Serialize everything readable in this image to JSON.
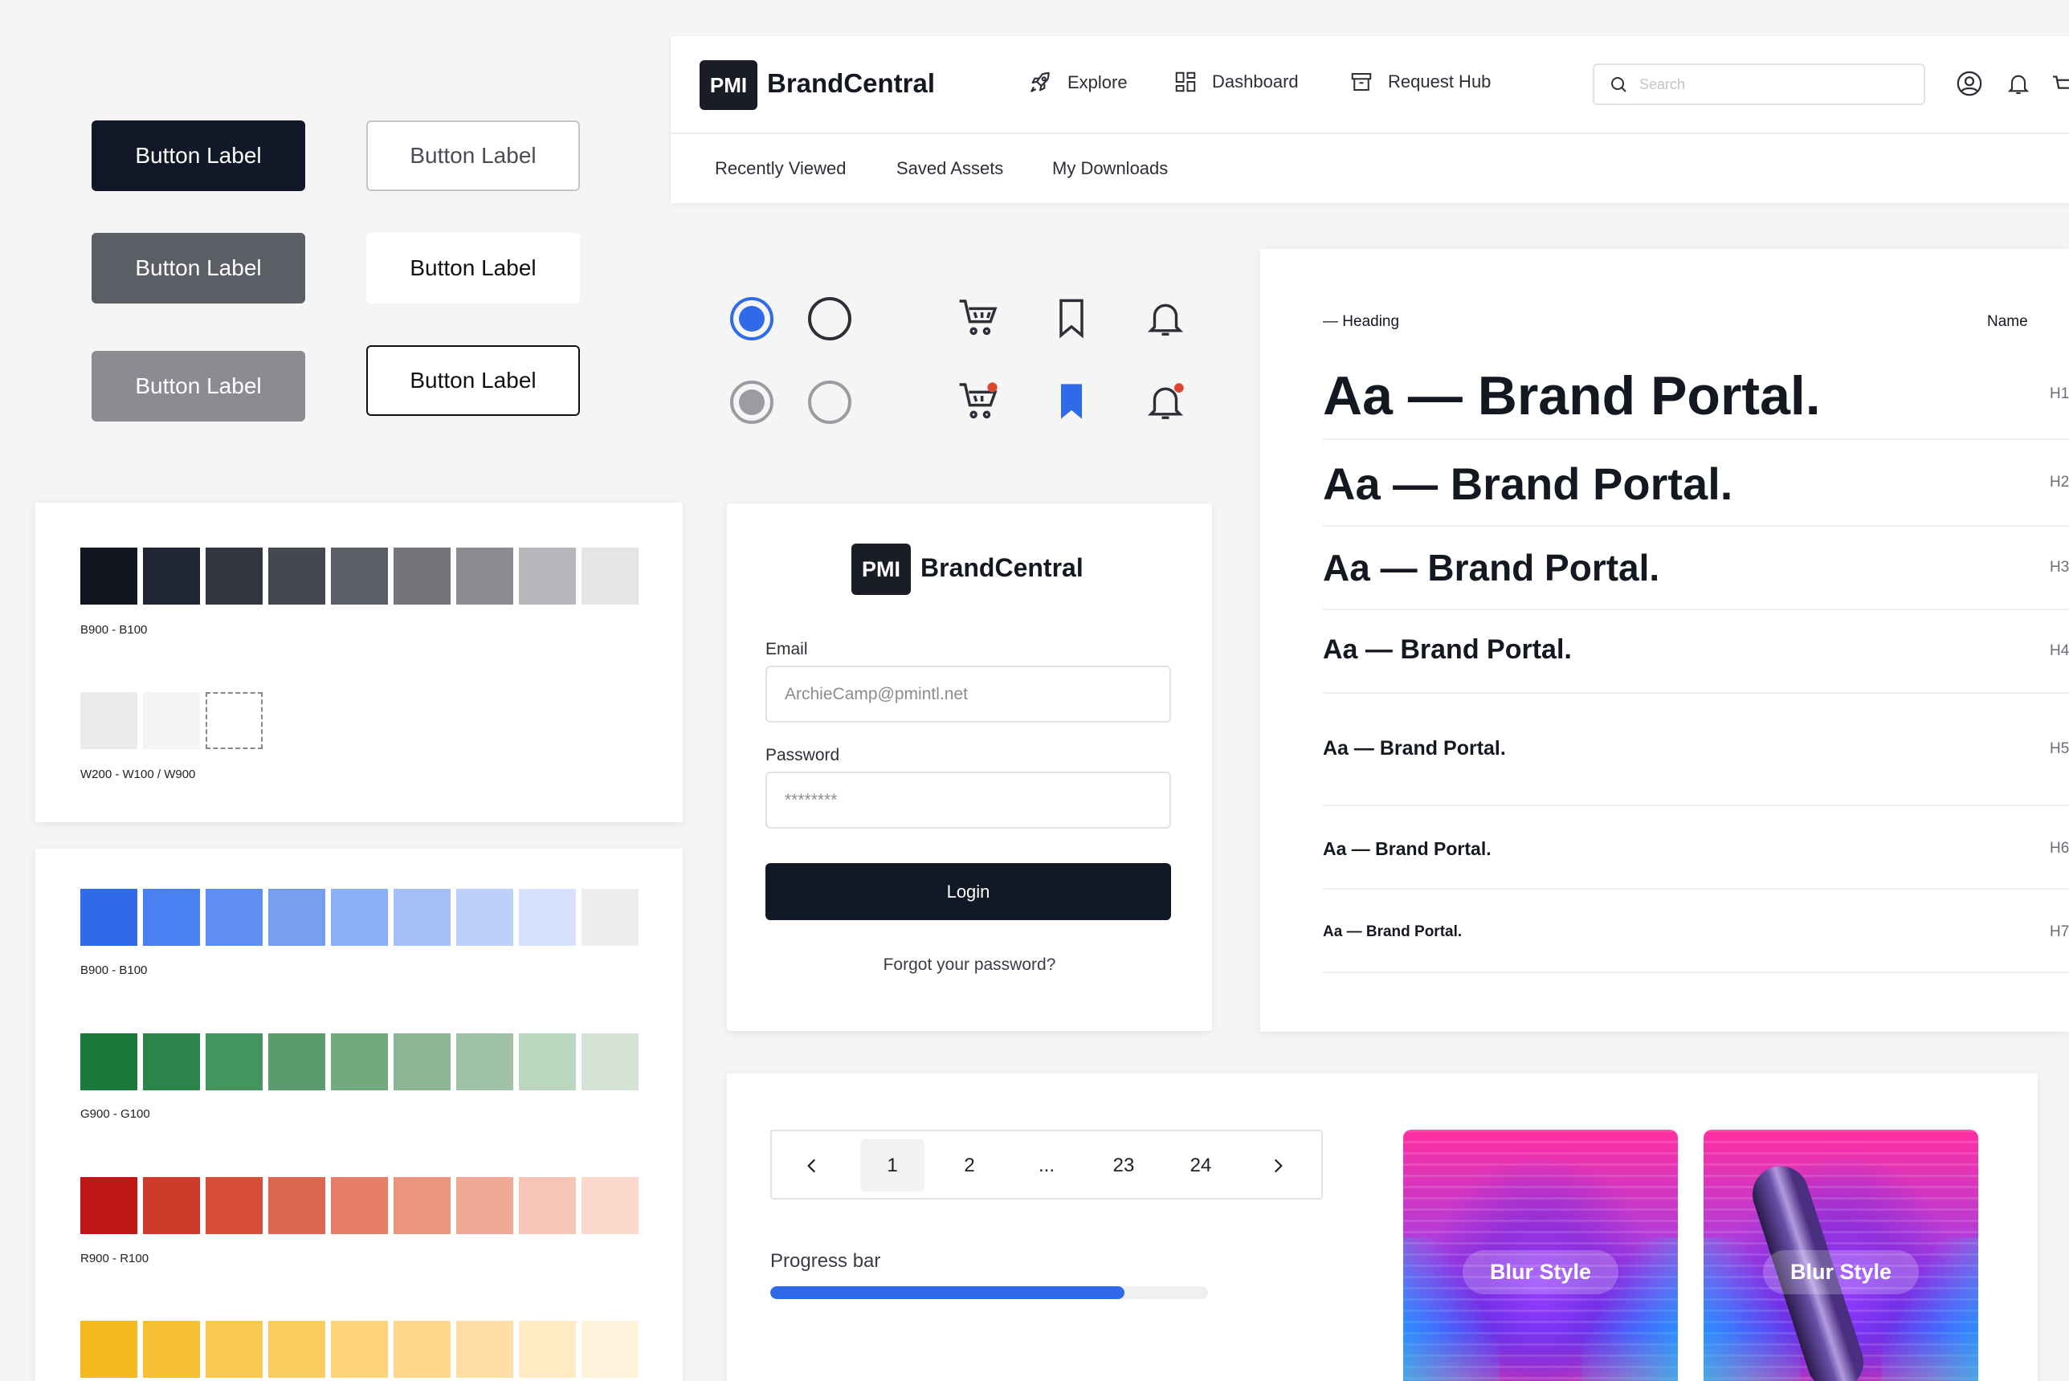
{
  "buttons": [
    {
      "label": "Button Label"
    },
    {
      "label": "Button Label"
    },
    {
      "label": "Button Label"
    },
    {
      "label": "Button Label"
    },
    {
      "label": "Button Label"
    },
    {
      "label": "Button Label"
    }
  ],
  "nav": {
    "logo": "PMI",
    "brand": "BrandCentral",
    "items": [
      {
        "label": "Explore",
        "icon": "rocket-icon"
      },
      {
        "label": "Dashboard",
        "icon": "dashboard-icon"
      },
      {
        "label": "Request Hub",
        "icon": "archive-icon"
      }
    ],
    "search_placeholder": "Search",
    "subnav": [
      "Recently Viewed",
      "Saved Assets",
      "My Downloads"
    ]
  },
  "palettes": {
    "neutral": {
      "label": "B900 - B100",
      "colors": [
        "#111620",
        "#202533",
        "#323641",
        "#454851",
        "#5c5e66",
        "#727479",
        "#8a8c92",
        "#b6b7bb",
        "#e5e5e5"
      ]
    },
    "white": {
      "label": "W200 - W100 / W900",
      "colors": [
        "#ebebeb",
        "#f4f4f4",
        "dashed"
      ]
    },
    "blue": {
      "label": "B900 - B100",
      "colors": [
        "#2f6ae8",
        "#4a80ef",
        "#5e8ff0",
        "#769ff2",
        "#8baff5",
        "#a5c0f7",
        "#bcd0f9",
        "#d6e2fb",
        "#ededed"
      ]
    },
    "green": {
      "label": "G900 - G100",
      "colors": [
        "#1a7a3c",
        "#2b854a",
        "#43945d",
        "#5c9b6d",
        "#73a97e",
        "#8ab694",
        "#a0c2a6",
        "#bcd7bf",
        "#d5e3d5"
      ]
    },
    "red": {
      "label": "R900 - R100",
      "colors": [
        "#c11616",
        "#cc3a2a",
        "#d64e37",
        "#dd6650",
        "#e57d68",
        "#e99580",
        "#f0a995",
        "#f6c5b8",
        "#fbd9cd"
      ]
    },
    "yellow": {
      "colors": [
        "#f5b820",
        "#f7bf33",
        "#f9c84f",
        "#fbcd60",
        "#fdd478",
        "#ffd88c",
        "#ffdeA3",
        "#ffeac4",
        "#fff2da"
      ]
    }
  },
  "login": {
    "logo": "PMI",
    "brand": "BrandCentral",
    "email_label": "Email",
    "email_value": "ArchieCamp@pmintl.net",
    "password_label": "Password",
    "password_value": "********",
    "login_label": "Login",
    "forgot": "Forgot your password?"
  },
  "typography": {
    "col_heading": "Heading",
    "col_name": "Name",
    "rows": [
      {
        "sample": "Aa — Brand Portal.",
        "tag": "H1"
      },
      {
        "sample": "Aa — Brand Portal.",
        "tag": "H2"
      },
      {
        "sample": "Aa — Brand Portal.",
        "tag": "H3"
      },
      {
        "sample": "Aa — Brand Portal.",
        "tag": "H4"
      },
      {
        "sample": "Aa — Brand Portal.",
        "tag": "H5"
      },
      {
        "sample": "Aa — Brand Portal.",
        "tag": "H6"
      },
      {
        "sample": "Aa — Brand Portal.",
        "tag": "H7"
      }
    ]
  },
  "pagination": {
    "pages": [
      "1",
      "2",
      "...",
      "23",
      "24"
    ],
    "active": "1"
  },
  "progress": {
    "label": "Progress bar",
    "value": 0.81
  },
  "blur_cards": [
    {
      "label": "Blur Style"
    },
    {
      "label": "Blur Style"
    }
  ],
  "colors": {
    "accent": "#2f6ae8",
    "dark": "#111827",
    "notification": "#e0462e"
  }
}
